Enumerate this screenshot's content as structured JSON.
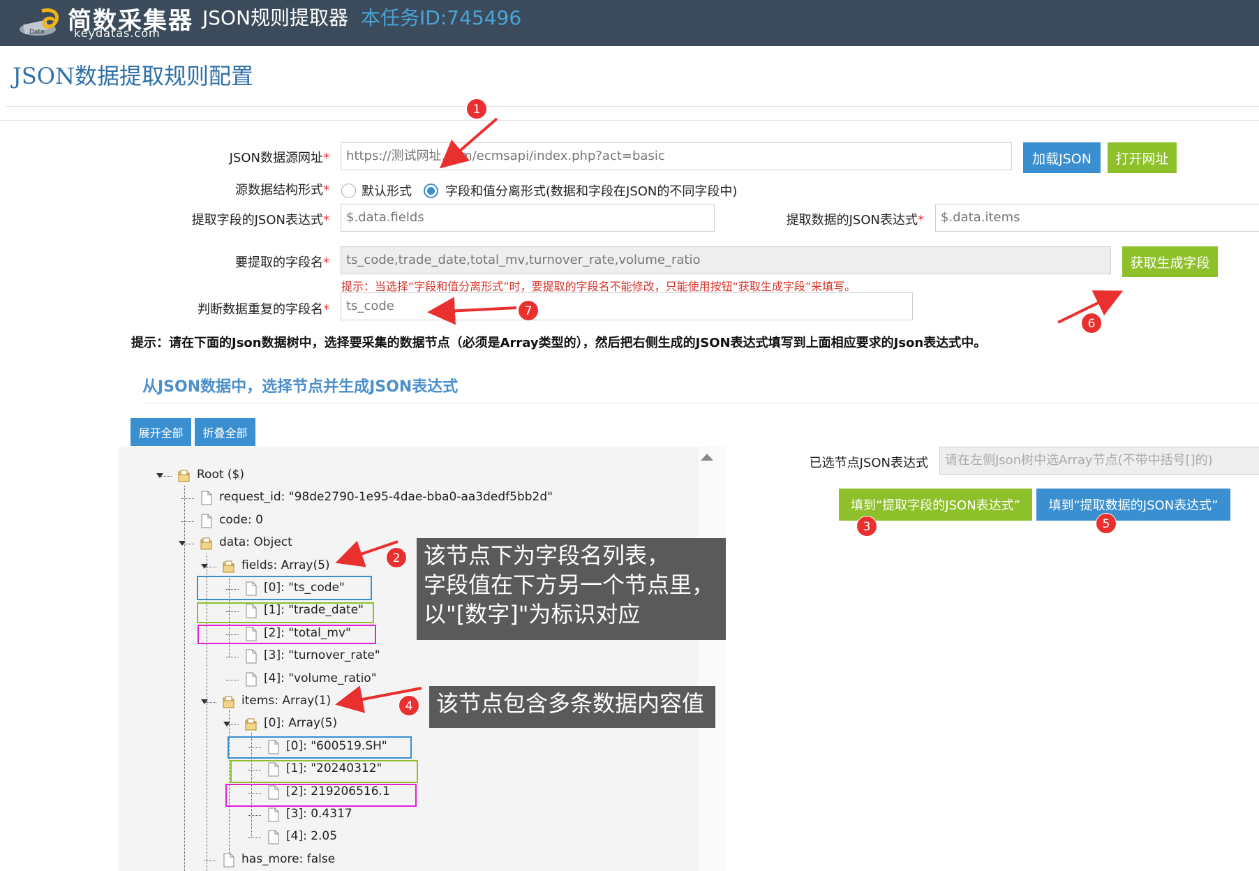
{
  "header": {
    "logo_text": "简数采集器",
    "logo_domain": "keydatas.com",
    "app_title": "JSON规则提取器",
    "task_label": "本任务ID:745496"
  },
  "page_title": "JSON数据提取规则配置",
  "form": {
    "source_url": {
      "label": "JSON数据源网址",
      "required": "*",
      "value": "https://测试网址.com/ecmsapi/index.php?act=basic"
    },
    "load_json_button": "加载JSON",
    "open_url_button": "打开网址",
    "structure": {
      "label": "源数据结构形式",
      "required": "*",
      "options": [
        "默认形式",
        "字段和值分离形式(数据和字段在JSON的不同字段中)"
      ],
      "selected_index": 1
    },
    "fields_expr": {
      "label": "提取字段的JSON表达式",
      "required": "*",
      "value": "$.data.fields"
    },
    "data_expr": {
      "label": "提取数据的JSON表达式",
      "required": "*",
      "value": "$.data.items"
    },
    "field_names": {
      "label": "要提取的字段名",
      "required": "*",
      "value": "ts_code,trade_date,total_mv,turnover_rate,volume_ratio"
    },
    "get_fields_button": "获取生成字段",
    "field_names_tip": "提示：当选择“字段和值分离形式”时，要提取的字段名不能修改，只能使用按钮“获取生成字段”来填写。",
    "dedup": {
      "label": "判断数据重复的字段名",
      "required": "*",
      "value": "ts_code"
    }
  },
  "main_tip": "提示：请在下面的Json数据树中，选择要采集的数据节点（必须是Array类型的），然后把右侧生成的JSON表达式填写到上面相应要求的Json表达式中。",
  "section_title": "从JSON数据中，选择节点并生成JSON表达式",
  "tree_toolbar": {
    "expand_all": "展开全部",
    "collapse_all": "折叠全部"
  },
  "tree": {
    "nodes": [
      {
        "text": "Root ($)",
        "type": "folder"
      },
      {
        "text": "request_id: \"98de2790-1e95-4dae-bba0-aa3dedf5bb2d\"",
        "type": "file"
      },
      {
        "text": "code: 0",
        "type": "file"
      },
      {
        "text": "data: Object",
        "type": "folder"
      },
      {
        "text": "fields: Array(5)",
        "type": "folder"
      },
      {
        "text": "[0]: \"ts_code\"",
        "type": "file"
      },
      {
        "text": "[1]: \"trade_date\"",
        "type": "file"
      },
      {
        "text": "[2]: \"total_mv\"",
        "type": "file"
      },
      {
        "text": "[3]: \"turnover_rate\"",
        "type": "file"
      },
      {
        "text": "[4]: \"volume_ratio\"",
        "type": "file"
      },
      {
        "text": "items: Array(1)",
        "type": "folder"
      },
      {
        "text": "[0]: Array(5)",
        "type": "folder"
      },
      {
        "text": "[0]: \"600519.SH\"",
        "type": "file"
      },
      {
        "text": "[1]: \"20240312\"",
        "type": "file"
      },
      {
        "text": "[2]: 219206516.1",
        "type": "file"
      },
      {
        "text": "[3]: 0.4317",
        "type": "file"
      },
      {
        "text": "[4]: 2.05",
        "type": "file"
      },
      {
        "text": "has_more: false",
        "type": "file"
      }
    ]
  },
  "selected_expr": {
    "label": "已选节点JSON表达式",
    "placeholder": "请在左侧Json树中选Array节点(不带中括号[]的)"
  },
  "fill_fields_button": "填到“提取字段的JSON表达式”",
  "fill_data_button": "填到“提取数据的JSON表达式”",
  "callouts": {
    "fields_note": "该节点下为字段名列表，\n字段值在下方另一个节点里，\n以\"[数字]\"为标识对应",
    "items_note": "该节点包含多条数据内容值"
  },
  "badges": [
    "1",
    "2",
    "3",
    "4",
    "5",
    "6",
    "7"
  ],
  "colors": {
    "header_bg": "#3b4b5b",
    "primary_blue": "#3a8fd0",
    "green": "#8ec02a",
    "badge_red": "#ea2f2f",
    "highlight_blue": "#3a8fd0",
    "highlight_green": "#8ec02a",
    "highlight_magenta": "#e020d8"
  }
}
